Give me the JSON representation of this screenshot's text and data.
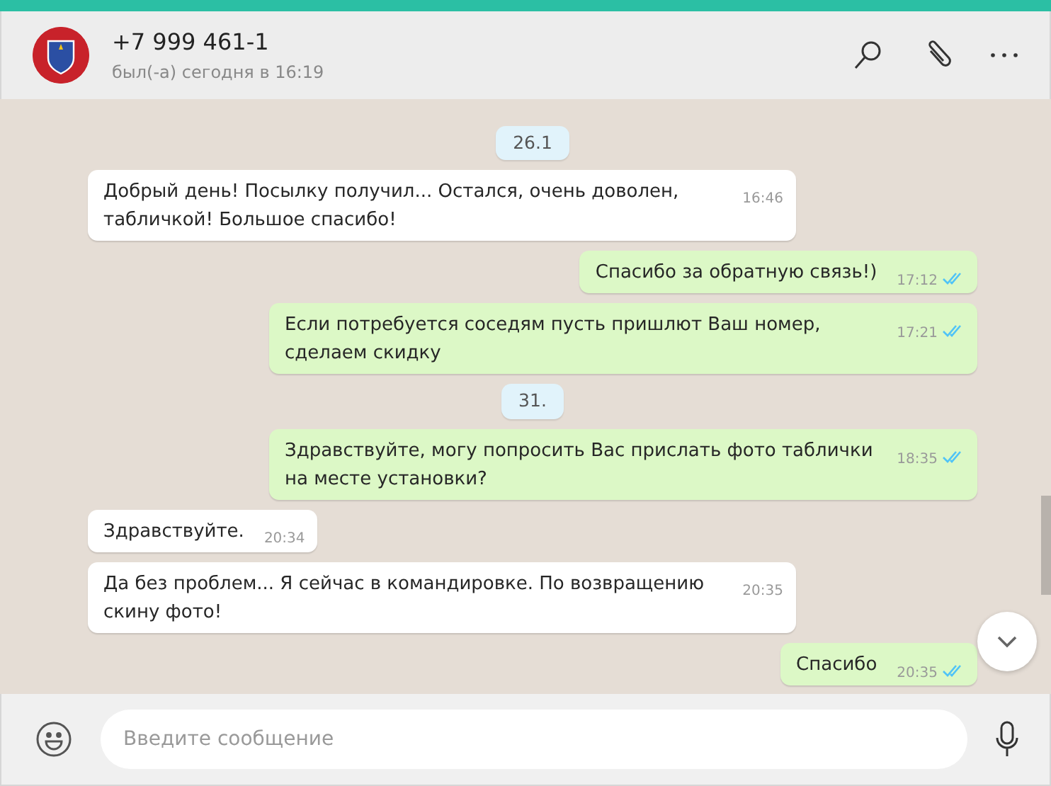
{
  "header": {
    "contact_name": "+7 999 461-1",
    "last_seen": "был(-а) сегодня в 16:19"
  },
  "messages": [
    {
      "kind": "date",
      "text": "26.1"
    },
    {
      "kind": "in",
      "text": "Добрый день! Посылку получил... Остался, очень доволен, табличкой! Большое спасибо!",
      "time": "16:46"
    },
    {
      "kind": "out",
      "text": "Спасибо за обратную связь!)",
      "time": "17:12",
      "read": true
    },
    {
      "kind": "out",
      "text": "Если потребуется соседям пусть пришлют Ваш номер, сделаем скидку",
      "time": "17:21",
      "read": true
    },
    {
      "kind": "date",
      "text": "31."
    },
    {
      "kind": "out",
      "text": "Здравствуйте, могу попросить Вас прислать фото таблички на месте установки?",
      "time": "18:35",
      "read": true
    },
    {
      "kind": "in",
      "text": "Здравствуйте.",
      "time": "20:34"
    },
    {
      "kind": "in",
      "text": "Да без проблем... Я сейчас в командировке. По возвращению скину фото!",
      "time": "20:35"
    },
    {
      "kind": "out",
      "text": "Спасибо",
      "time": "20:35",
      "read": true
    }
  ],
  "composer": {
    "placeholder": "Введите сообщение"
  }
}
